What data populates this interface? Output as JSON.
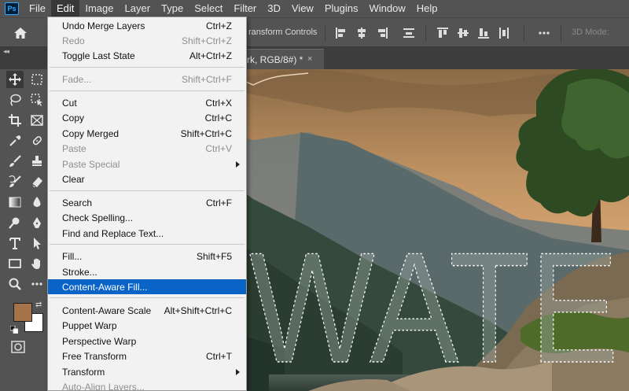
{
  "app": {
    "logo_text": "Ps"
  },
  "menubar": {
    "items": [
      "File",
      "Edit",
      "Image",
      "Layer",
      "Type",
      "Select",
      "Filter",
      "3D",
      "View",
      "Plugins",
      "Window",
      "Help"
    ]
  },
  "options_bar": {
    "transform_controls_label": "ransform Controls",
    "three_d_mode_label": "3D Mode:"
  },
  "document_tab": {
    "title": "rk, RGB/8#) *",
    "close_glyph": "×"
  },
  "canvas": {
    "selection_text": "WATE"
  },
  "toolbar": {
    "foreground_color": "#a4734a",
    "background_color": "#ffffff"
  },
  "edit_menu": {
    "items": [
      {
        "label": "Undo Merge Layers",
        "shortcut": "Ctrl+Z",
        "disabled": false
      },
      {
        "label": "Redo",
        "shortcut": "Shift+Ctrl+Z",
        "disabled": true
      },
      {
        "label": "Toggle Last State",
        "shortcut": "Alt+Ctrl+Z",
        "disabled": false
      },
      {
        "label": "Fade...",
        "shortcut": "Shift+Ctrl+F",
        "disabled": true
      },
      {
        "label": "Cut",
        "shortcut": "Ctrl+X",
        "disabled": false
      },
      {
        "label": "Copy",
        "shortcut": "Ctrl+C",
        "disabled": false
      },
      {
        "label": "Copy Merged",
        "shortcut": "Shift+Ctrl+C",
        "disabled": false
      },
      {
        "label": "Paste",
        "shortcut": "Ctrl+V",
        "disabled": true
      },
      {
        "label": "Paste Special",
        "shortcut": "",
        "disabled": true,
        "submenu": true
      },
      {
        "label": "Clear",
        "shortcut": "",
        "disabled": false
      },
      {
        "label": "Search",
        "shortcut": "Ctrl+F",
        "disabled": false
      },
      {
        "label": "Check Spelling...",
        "shortcut": "",
        "disabled": false
      },
      {
        "label": "Find and Replace Text...",
        "shortcut": "",
        "disabled": false
      },
      {
        "label": "Fill...",
        "shortcut": "Shift+F5",
        "disabled": false
      },
      {
        "label": "Stroke...",
        "shortcut": "",
        "disabled": false
      },
      {
        "label": "Content-Aware Fill...",
        "shortcut": "",
        "disabled": false,
        "highlighted": true
      },
      {
        "label": "Content-Aware Scale",
        "shortcut": "Alt+Shift+Ctrl+C",
        "disabled": false
      },
      {
        "label": "Puppet Warp",
        "shortcut": "",
        "disabled": false
      },
      {
        "label": "Perspective Warp",
        "shortcut": "",
        "disabled": false
      },
      {
        "label": "Free Transform",
        "shortcut": "Ctrl+T",
        "disabled": false
      },
      {
        "label": "Transform",
        "shortcut": "",
        "disabled": false,
        "submenu": true
      },
      {
        "label": "Auto-Align Layers...",
        "shortcut": "",
        "disabled": true
      }
    ]
  },
  "colors": {
    "menu_highlight": "#0a64c8",
    "ui_panel": "#535353",
    "ui_dark": "#3d3d3d"
  }
}
